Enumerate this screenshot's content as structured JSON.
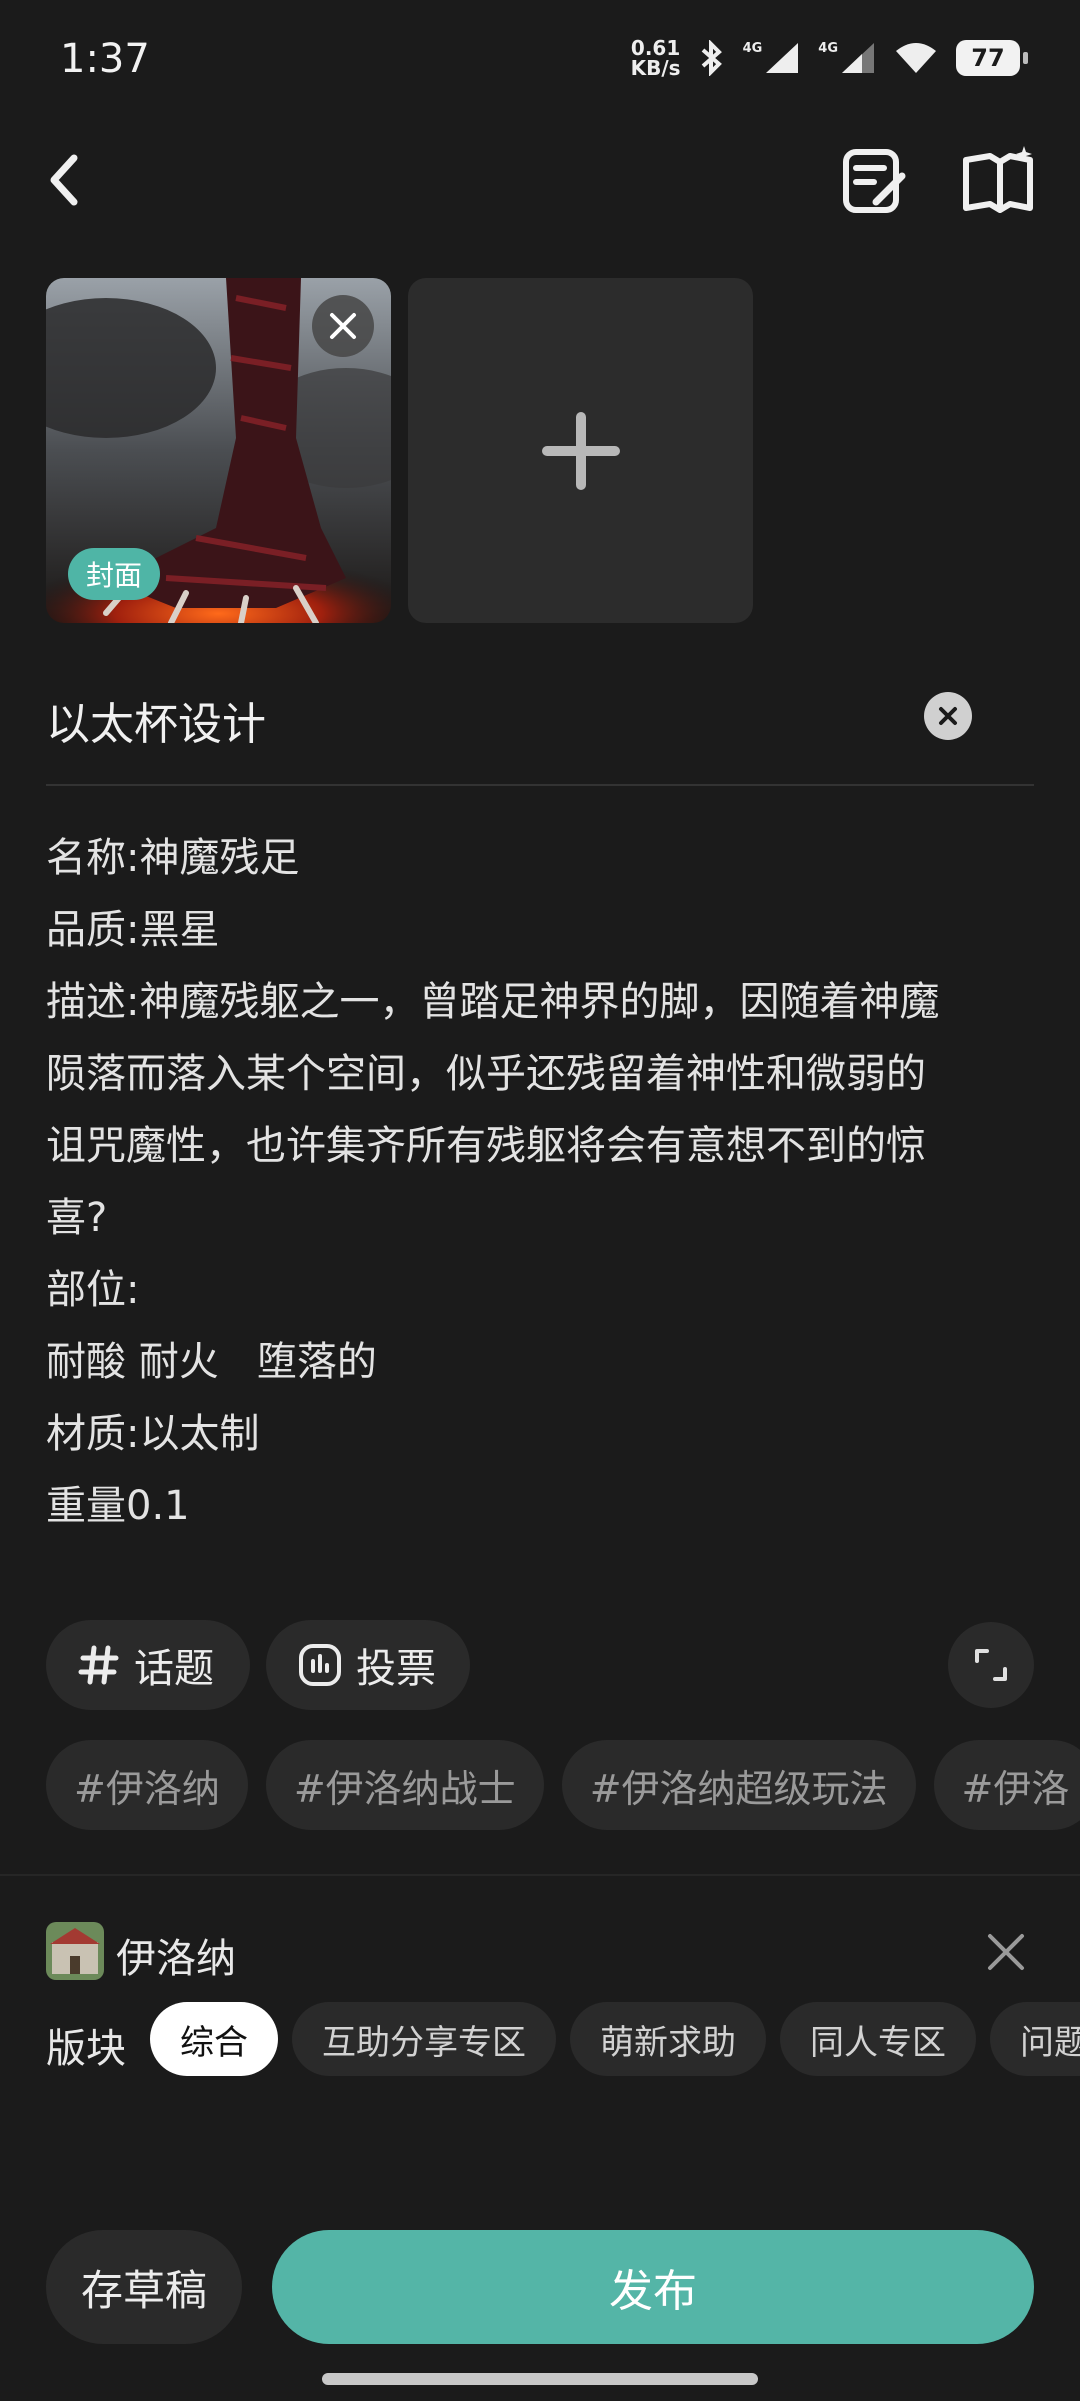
{
  "status_bar": {
    "time": "1:37",
    "net_speed_value": "0.61",
    "net_speed_unit": "KB/s",
    "network_1": "4G",
    "network_2": "4G",
    "battery": "77"
  },
  "images": {
    "cover_label": "封面"
  },
  "title": "以太杯设计",
  "body_lines": [
    "名称:神魔残足",
    "品质:黑星",
    "描述:神魔残躯之一，曾踏足神界的脚，因随着神魔",
    "陨落而落入某个空间，似乎还残留着神性和微弱的",
    "诅咒魔性，也许集齐所有残躯将会有意想不到的惊",
    "喜?",
    "部位:",
    "耐酸 耐火   堕落的",
    "材质:以太制",
    "重量0.1"
  ],
  "tools": {
    "topic_label": "话题",
    "vote_label": "投票"
  },
  "tags": [
    "#伊洛纳",
    "#伊洛纳战士",
    "#伊洛纳超级玩法",
    "#伊洛"
  ],
  "game": {
    "name": "伊洛纳"
  },
  "board": {
    "label": "版块",
    "chips": [
      "综合",
      "互助分享专区",
      "萌新求助",
      "同人专区",
      "问题"
    ],
    "selected": "综合"
  },
  "actions": {
    "draft_label": "存草稿",
    "publish_label": "发布"
  },
  "colors": {
    "accent": "#54b5a7",
    "background": "#1b1b1b"
  }
}
